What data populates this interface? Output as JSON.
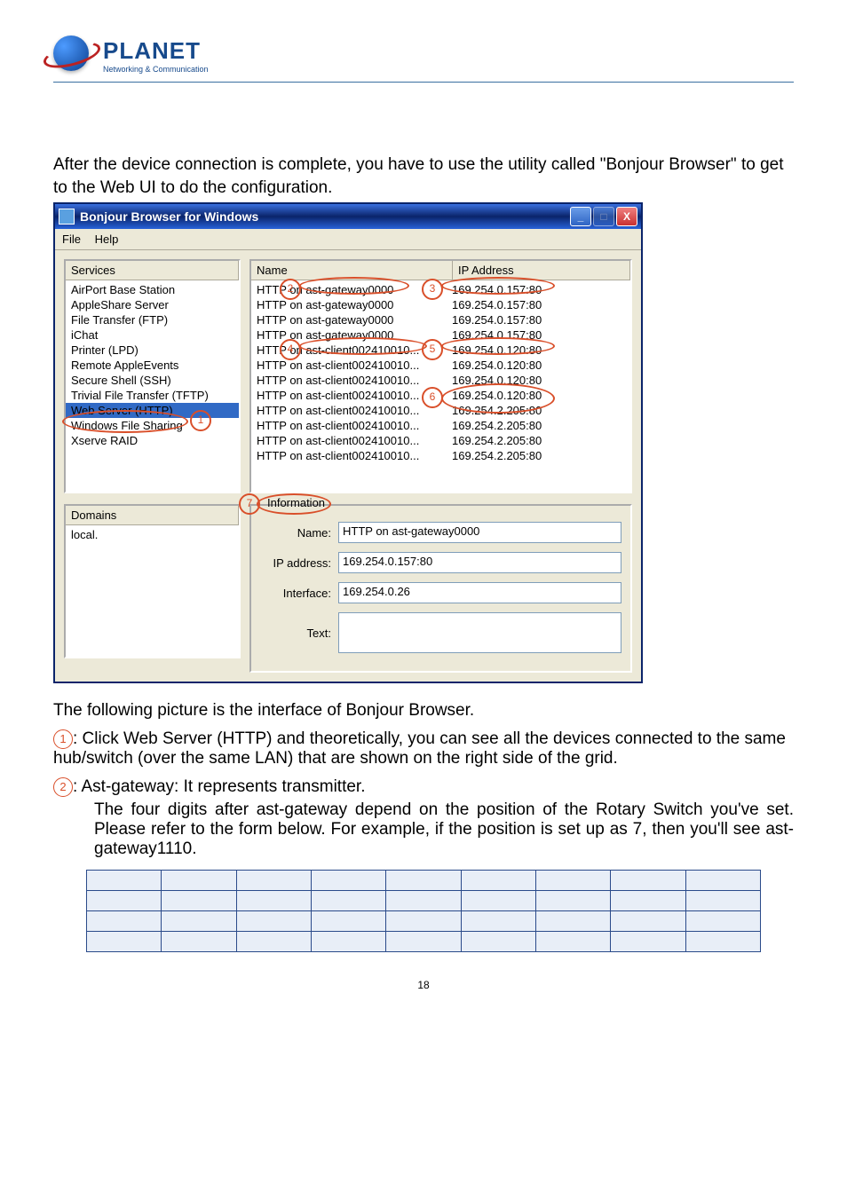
{
  "logo": {
    "title": "PLANET",
    "sub": "Networking & Communication"
  },
  "intro": "After the device connection is complete, you have to use the utility called \"Bonjour Browser\" to get to the Web UI to do the configuration.",
  "window": {
    "title": "Bonjour Browser for Windows",
    "menu": {
      "file": "File",
      "help": "Help"
    },
    "services": {
      "header": "Services",
      "items": [
        "AirPort Base Station",
        "AppleShare Server",
        "File Transfer (FTP)",
        "iChat",
        "Printer (LPD)",
        "Remote AppleEvents",
        "Secure Shell (SSH)",
        "Trivial File Transfer (TFTP)",
        "Web Server (HTTP)",
        "Windows File Sharing",
        "Xserve RAID"
      ]
    },
    "main": {
      "col1": "Name",
      "col2": "IP Address",
      "rows": [
        {
          "name": "HTTP on ast-gateway0000",
          "ip": "169.254.0.157:80",
          "sel": true
        },
        {
          "name": "HTTP on ast-gateway0000",
          "ip": "169.254.0.157:80"
        },
        {
          "name": "HTTP on ast-gateway0000",
          "ip": "169.254.0.157:80"
        },
        {
          "name": "HTTP on ast-gateway0000",
          "ip": "169.254.0.157:80"
        },
        {
          "name": "HTTP on ast-client002410010...",
          "ip": "169.254.0.120:80"
        },
        {
          "name": "HTTP on ast-client002410010...",
          "ip": "169.254.0.120:80"
        },
        {
          "name": "HTTP on ast-client002410010...",
          "ip": "169.254.0.120:80"
        },
        {
          "name": "HTTP on ast-client002410010...",
          "ip": "169.254.0.120:80"
        },
        {
          "name": "HTTP on ast-client002410010...",
          "ip": "169.254.2.205:80"
        },
        {
          "name": "HTTP on ast-client002410010...",
          "ip": "169.254.2.205:80"
        },
        {
          "name": "HTTP on ast-client002410010...",
          "ip": "169.254.2.205:80"
        },
        {
          "name": "HTTP on ast-client002410010...",
          "ip": "169.254.2.205:80"
        }
      ]
    },
    "domains": {
      "header": "Domains",
      "items": [
        "local."
      ]
    },
    "info": {
      "title": "Information",
      "name_label": "Name:",
      "name_val": "HTTP on ast-gateway0000",
      "ip_label": "IP address:",
      "ip_val": "169.254.0.157:80",
      "iface_label": "Interface:",
      "iface_val": "169.254.0.26",
      "text_label": "Text:",
      "text_val": ""
    }
  },
  "after": "The following picture is the interface of Bonjour Browser.",
  "bullets": {
    "b1": ": Click Web Server (HTTP) and theoretically, you can see all the devices connected to the same hub/switch (over the same LAN) that are shown on the right side of the grid.",
    "b2a": ": Ast-gateway: It represents transmitter.",
    "b2b": "The four digits after ast-gateway depend on the position of the Rotary Switch you've set. Please refer to the form below. For example, if the position is set up as 7, then you'll see ast-gateway1110."
  },
  "pagenum": "18"
}
